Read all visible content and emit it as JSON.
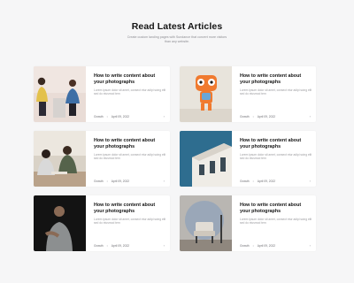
{
  "section": {
    "title": "Read Latest Articles",
    "subtitle": "Create custom landing pages with Sundance that convert more visitors than any website."
  },
  "articles": [
    {
      "title": "How to write content about your photographs",
      "excerpt": "Lorem ipsum dolor sit amet, consect etur adipi scing elit sed do eiusmod tem",
      "category": "Growth",
      "date": "April 09, 2022",
      "image": "two-women-chatting-photo"
    },
    {
      "title": "How to write content about your photographs",
      "excerpt": "Lorem ipsum dolor sit amet, consect etur adipi scing elit sed do eiusmod tem",
      "category": "Growth",
      "date": "April 09, 2022",
      "image": "orange-3d-character-photo"
    },
    {
      "title": "How to write content about your photographs",
      "excerpt": "Lorem ipsum dolor sit amet, consect etur adipi scing elit sed do eiusmod tem",
      "category": "Growth",
      "date": "April 09, 2022",
      "image": "women-at-table-photo"
    },
    {
      "title": "How to write content about your photographs",
      "excerpt": "Lorem ipsum dolor sit amet, consect etur adipi scing elit sed do eiusmod tem",
      "category": "Growth",
      "date": "April 09, 2022",
      "image": "building-blue-sky-photo"
    },
    {
      "title": "How to write content about your photographs",
      "excerpt": "Lorem ipsum dolor sit amet, consect etur adipi scing elit sed do eiusmod tem",
      "category": "Growth",
      "date": "April 09, 2022",
      "image": "man-dark-background-photo"
    },
    {
      "title": "How to write content about your photographs",
      "excerpt": "Lorem ipsum dolor sit amet, consect etur adipi scing elit sed do eiusmod tem",
      "category": "Growth",
      "date": "April 09, 2022",
      "image": "chair-interior-photo"
    }
  ],
  "colors": {
    "background": "#f6f6f7",
    "card": "#ffffff",
    "heading": "#151515",
    "muted": "#9a9a9e"
  }
}
